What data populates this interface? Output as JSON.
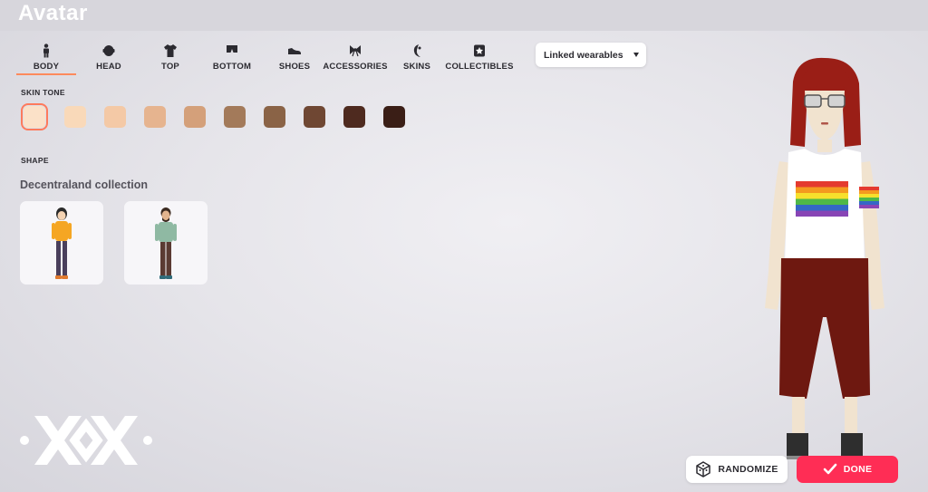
{
  "header": {
    "title": "Avatar"
  },
  "tabs": [
    {
      "label": "BODY",
      "icon": "body-icon",
      "active": true
    },
    {
      "label": "HEAD",
      "icon": "head-icon",
      "active": false
    },
    {
      "label": "TOP",
      "icon": "shirt-icon",
      "active": false
    },
    {
      "label": "BOTTOM",
      "icon": "pants-icon",
      "active": false
    },
    {
      "label": "SHOES",
      "icon": "shoe-icon",
      "active": false
    },
    {
      "label": "ACCESSORIES",
      "icon": "bow-icon",
      "active": false
    },
    {
      "label": "SKINS",
      "icon": "skin-icon",
      "active": false
    },
    {
      "label": "COLLECTIBLES",
      "icon": "collectible-icon",
      "active": false
    }
  ],
  "filter_dropdown": {
    "value": "Linked wearables"
  },
  "skin_tone": {
    "label": "SKIN TONE",
    "selected_index": 0,
    "colors": [
      "#fbe1c8",
      "#f9d9b9",
      "#f4c9a6",
      "#e6b48f",
      "#d4a07a",
      "#a37a5a",
      "#8a6346",
      "#6f4733",
      "#4e2a1f",
      "#3a1e16"
    ]
  },
  "shape": {
    "label": "SHAPE",
    "collection_title": "Decentraland collection",
    "options": [
      "female-body-shape",
      "male-body-shape"
    ]
  },
  "logo": {
    "icon": "decentraland-xx-logo"
  },
  "buttons": {
    "randomize": "RANDOMIZE",
    "done": "DONE"
  },
  "colors": {
    "accent": "#ff2d55",
    "active_tab_underline": "#ff8a5c"
  }
}
